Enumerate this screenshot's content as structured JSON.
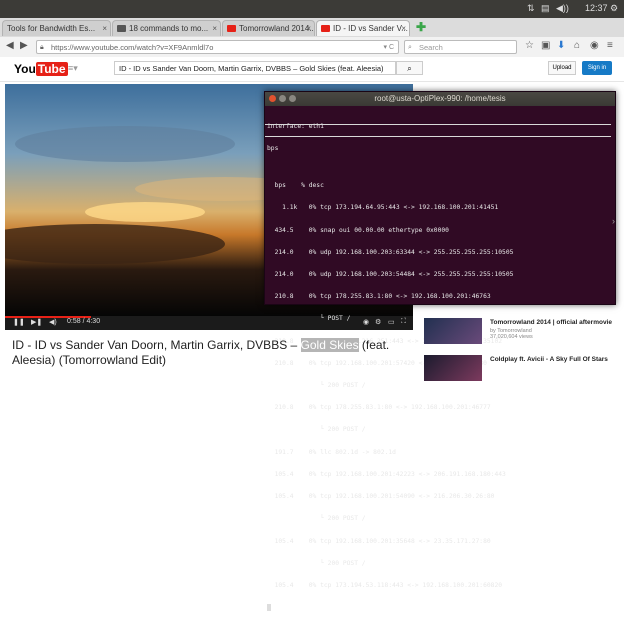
{
  "system": {
    "clock": "12:37",
    "indicators": [
      "network-icon",
      "keyboard-icon",
      "volume-icon",
      "gear-icon"
    ]
  },
  "tabs": [
    {
      "label": "Tools for Bandwidth Es...",
      "active": false,
      "favicon": "#888888"
    },
    {
      "label": "18 commands to mo...",
      "active": false,
      "favicon": "#555555"
    },
    {
      "label": "Tomorrowland 2014...",
      "active": false,
      "favicon": "#e62117"
    },
    {
      "label": "ID - ID vs Sander V...",
      "active": true,
      "favicon": "#e62117"
    }
  ],
  "nav": {
    "url": "https://www.youtube.com/watch?v=XF9Anmldl7o",
    "search_placeholder": "Search"
  },
  "youtube": {
    "logo_you": "You",
    "logo_tube": "Tube",
    "search_value": "ID - ID vs Sander Van Doorn, Martin Garrix, DVBBS – Gold Skies (feat. Aleesia)",
    "upload_label": "Upload",
    "signin_label": "Sign in",
    "time": "0:58 / 4:30",
    "progress": 0.21
  },
  "terminal": {
    "title": "root@usta-OptiPlex-990: /home/tesis",
    "lines": [
      "interface: eth1",
      "bps",
      "",
      "  bps    % desc",
      "    1.1k   0% tcp 173.194.64.95:443 <-> 192.168.100.201:41451",
      "  434.5    0% snap oui 00.00.00 ethertype 0x0000",
      "  214.0    0% udp 192.168.100.203:63344 <-> 255.255.255.255:10505",
      "  214.0    0% udp 192.168.100.203:54484 <-> 255.255.255.255:10505",
      "  210.8    0% tcp 178.255.83.1:80 <-> 192.168.100.201:46763",
      "              └ POST /",
      "  210.8    0% tcp 104.72.216.251:443 <-> 192.168.100.201:35102",
      "  210.8    0% tcp 192.168.100.201:57420 <-> 72.21.91.29:80",
      "              └ 200 POST /",
      "  210.8    0% tcp 178.255.83.1:80 <-> 192.168.100.201:46777",
      "              └ 200 POST /",
      "  191.7    0% llc 802.1d -> 802.1d",
      "  105.4    0% tcp 192.168.100.201:42223 <-> 206.191.168.180:443",
      "  105.4    0% tcp 192.168.100.201:54090 <-> 216.206.30.26:80",
      "              └ 200 POST /",
      "  105.4    0% tcp 192.168.100.201:35648 <-> 23.35.171.27:80",
      "              └ 200 POST /",
      "  105.4    0% tcp 173.194.53.118:443 <-> 192.168.100.201:60820"
    ]
  },
  "recommendations": [
    {
      "title": "Tomorrowland 2014 | official aftermovie",
      "channel": "by Tomorrowland",
      "views": "37,020,604 views"
    },
    {
      "title": "Coldplay ft. Avicii - A Sky Full Of Stars",
      "channel": "",
      "views": ""
    }
  ],
  "video_title": {
    "before": "ID - ID vs Sander Van Doorn, Martin Garrix, DVBBS – ",
    "highlight": "Gold Skies",
    "after": " (feat. Aleesia) (Tomorrowland Edit)"
  }
}
